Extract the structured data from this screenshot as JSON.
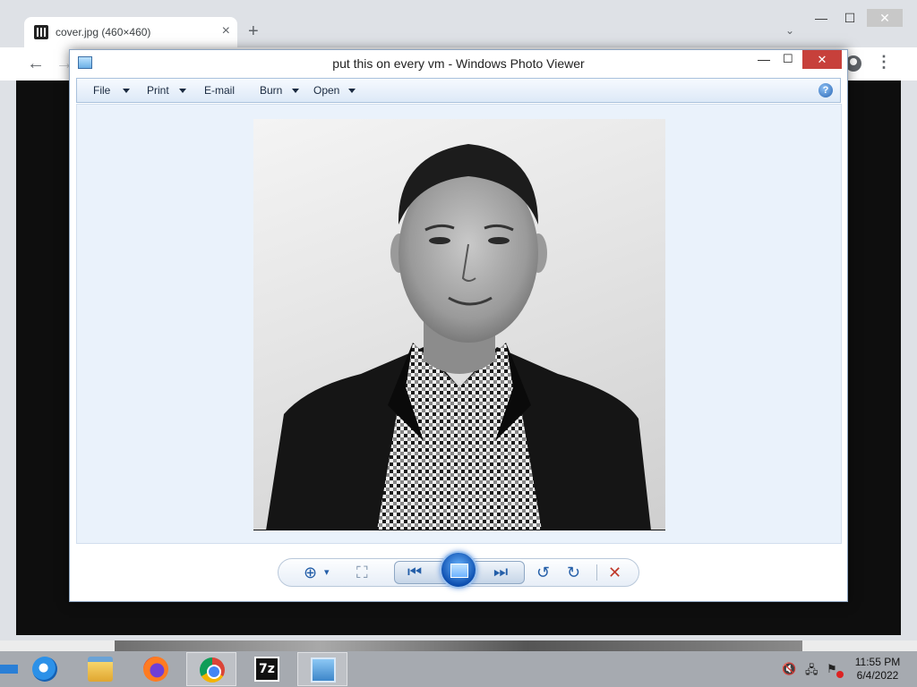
{
  "browser": {
    "tab_title": "cover.jpg (460×460)",
    "tab_close": "×",
    "new_tab": "+",
    "tab_search": "⌄",
    "window_min": "—",
    "window_max": "☐",
    "window_close": "✕",
    "back": "←",
    "forward": "→",
    "menu": "⋮"
  },
  "photo_viewer": {
    "title": "put this on every vm - Windows Photo Viewer",
    "min": "—",
    "max": "☐",
    "close": "✕",
    "menu": [
      {
        "label": "File",
        "dropdown": true
      },
      {
        "label": "Print",
        "dropdown": true
      },
      {
        "label": "E-mail",
        "dropdown": false
      },
      {
        "label": "Burn",
        "dropdown": true
      },
      {
        "label": "Open",
        "dropdown": true
      }
    ],
    "help": "?",
    "image_size": "460×460",
    "controls": {
      "zoom": "⊕",
      "zoom_caret": "▾",
      "fit": "⛶",
      "prev": "⏮",
      "next": "⏭",
      "rotate_ccw": "↺",
      "rotate_cw": "↻",
      "delete": "✕"
    }
  },
  "taskbar": {
    "items": [
      "internet-explorer",
      "file-explorer",
      "firefox",
      "chrome",
      "7-zip",
      "windows-photo-viewer"
    ],
    "seven_zip_label": "7z",
    "tray": {
      "volume": "🔇",
      "network": "🖧",
      "flag": "⚑"
    },
    "time": "11:55 PM",
    "date": "6/4/2022"
  },
  "colors": {
    "close_red": "#c7403b",
    "accent_blue": "#235ea8",
    "viewer_bg": "#eaf2fb"
  }
}
